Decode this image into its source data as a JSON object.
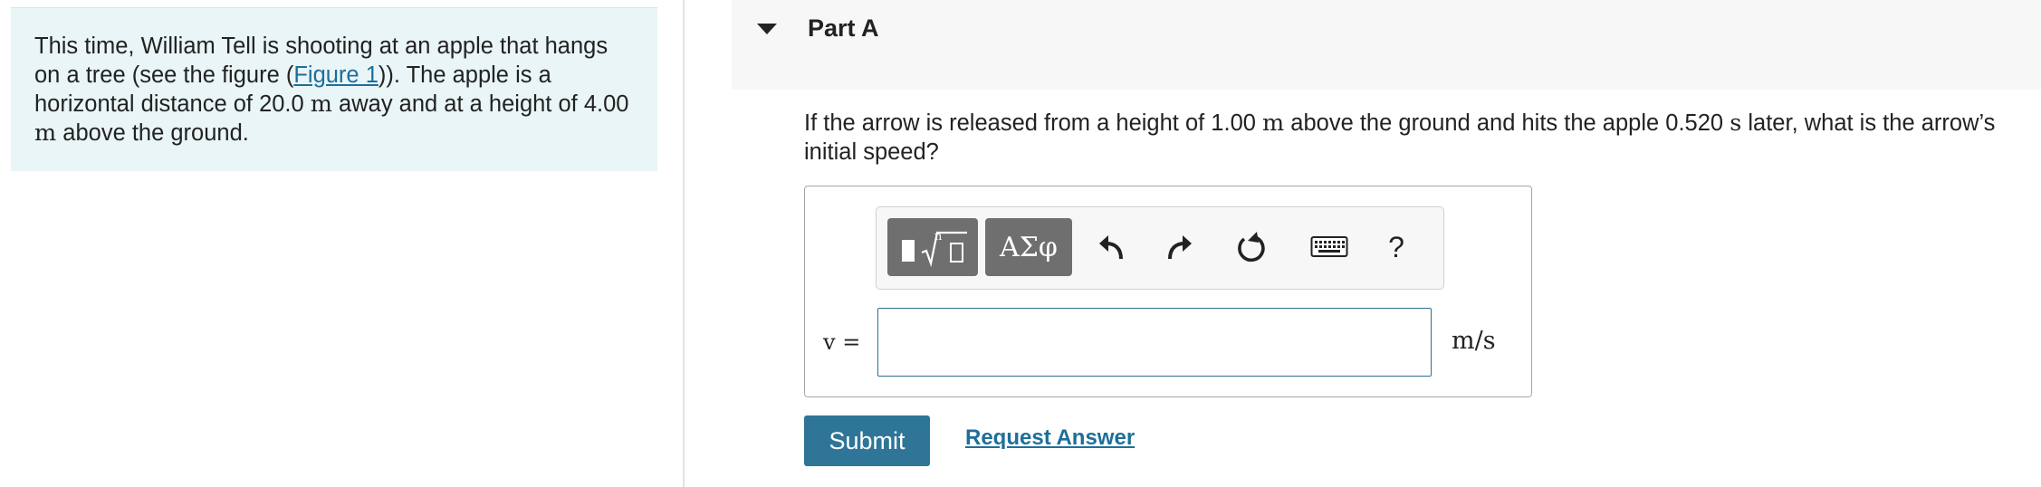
{
  "intro": {
    "text_1": "This time, William Tell is shooting at an apple that hangs on a tree (see the figure (",
    "figure_link": "Figure 1",
    "text_2": ")). The apple is a horizontal distance of 20.0 ",
    "unit_m_1": "m",
    "text_3": " away and at a height of 4.00 ",
    "unit_m_2": "m",
    "text_4": " above the ground."
  },
  "part": {
    "title": "Part A",
    "toggle_icon": "caret-down-icon"
  },
  "question": {
    "text_1": "If the arrow is released from a height of 1.00 ",
    "unit_m": "m",
    "text_2": " above the ground and hits the apple 0.520 ",
    "unit_s": "s",
    "text_3": " later, what is the arrow’s initial speed?"
  },
  "toolbar": {
    "templates_icon": "templates-sqrt-icon",
    "symbols_label": "ΑΣφ",
    "undo_icon": "undo-icon",
    "redo_icon": "redo-icon",
    "reset_icon": "reset-icon",
    "keyboard_icon": "keyboard-icon",
    "help_label": "?"
  },
  "answer": {
    "variable_label": "v =",
    "value": "",
    "unit_label": "m/s"
  },
  "actions": {
    "submit_label": "Submit",
    "request_answer_label": "Request Answer"
  }
}
